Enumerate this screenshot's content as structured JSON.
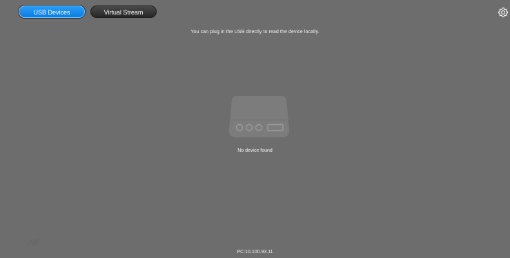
{
  "tabs": [
    {
      "label": "USB Devices",
      "active": true
    },
    {
      "label": "Virtual Stream",
      "active": false
    }
  ],
  "main": {
    "hint": "You can plug in the USB directly to read the device locally.",
    "empty_state": "No device found",
    "device_icon": "usb-drive-icon"
  },
  "footer": {
    "ip": "PC:10.100.93.11"
  },
  "icons": {
    "settings": "gear-icon"
  },
  "colors": {
    "background": "#6d6d6d",
    "active_tab": "#1a8cf0",
    "inactive_tab": "#333333"
  }
}
